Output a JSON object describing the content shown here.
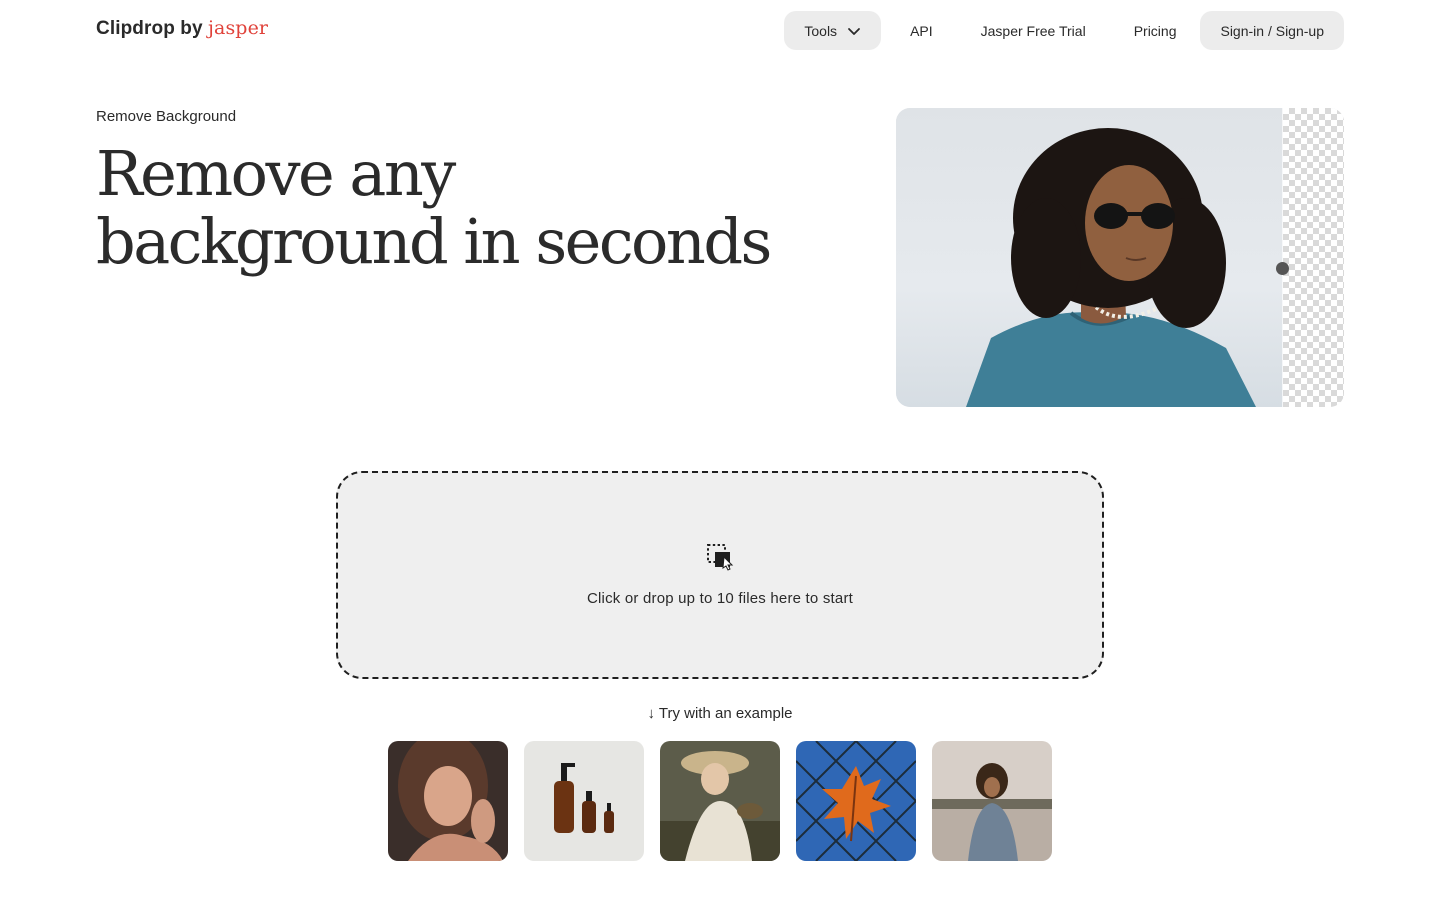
{
  "header": {
    "logo_brand": "Clipdrop by ",
    "logo_jasper": "jasper",
    "nav": {
      "tools": "Tools",
      "api": "API",
      "free_trial": "Jasper Free Trial",
      "pricing": "Pricing",
      "signin": "Sign-in / Sign-up"
    }
  },
  "hero": {
    "breadcrumb": "Remove Background",
    "title_line1": "Remove any",
    "title_line2": "background in seconds"
  },
  "dropzone": {
    "text": "Click or drop up to 10 files here to start",
    "icon": "drop-files-icon"
  },
  "examples": {
    "label": "↓ Try with an example",
    "items": [
      {
        "name": "woman-portrait"
      },
      {
        "name": "product-bottles"
      },
      {
        "name": "painting-woman-hat"
      },
      {
        "name": "autumn-leaf-fence"
      },
      {
        "name": "woman-lake"
      }
    ]
  },
  "colors": {
    "accent_jasper": "#e0423a",
    "nav_button_bg": "#ececec",
    "dropzone_bg": "#efefef"
  }
}
